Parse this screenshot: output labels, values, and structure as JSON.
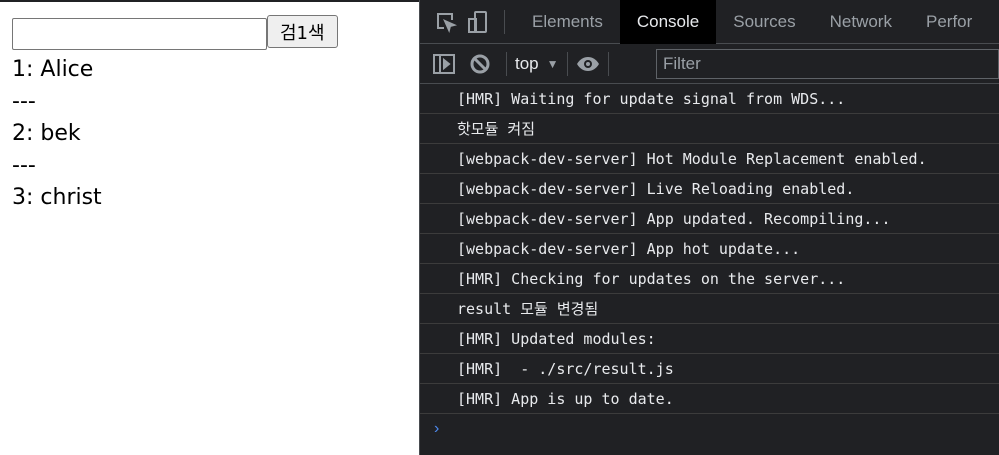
{
  "page": {
    "search_value": "",
    "search_button": "검1색",
    "lines": [
      "1: Alice",
      "---",
      "2: bek",
      "---",
      "3: christ"
    ]
  },
  "devtools": {
    "tabs": [
      "Elements",
      "Console",
      "Sources",
      "Network",
      "Perfor"
    ],
    "active_tab": "Console",
    "context": "top",
    "filter_placeholder": "Filter",
    "messages": [
      "[HMR] Waiting for update signal from WDS...",
      "핫모듈 켜짐",
      "[webpack-dev-server] Hot Module Replacement enabled.",
      "[webpack-dev-server] Live Reloading enabled.",
      "[webpack-dev-server] App updated. Recompiling...",
      "[webpack-dev-server] App hot update...",
      "[HMR] Checking for updates on the server...",
      "result 모듈 변경됨",
      "[HMR] Updated modules:",
      "[HMR]  - ./src/result.js",
      "[HMR] App is up to date."
    ],
    "prompt": "›"
  }
}
